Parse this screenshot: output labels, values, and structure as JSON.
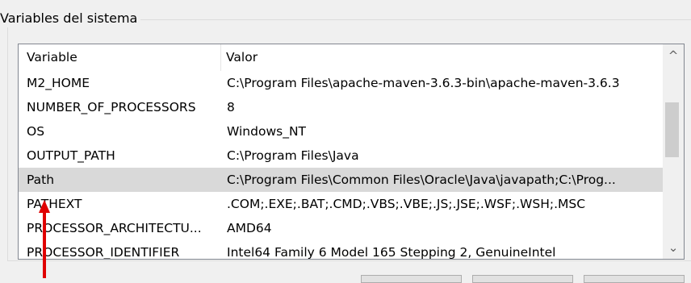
{
  "group": {
    "title": "Variables del sistema"
  },
  "list": {
    "columns": [
      "Variable",
      "Valor"
    ],
    "rows": [
      {
        "name": "M2_HOME",
        "value": "C:\\Program Files\\apache-maven-3.6.3-bin\\apache-maven-3.6.3"
      },
      {
        "name": "NUMBER_OF_PROCESSORS",
        "value": "8"
      },
      {
        "name": "OS",
        "value": "Windows_NT"
      },
      {
        "name": "OUTPUT_PATH",
        "value": "C:\\Program Files\\Java"
      },
      {
        "name": "Path",
        "value": "C:\\Program Files\\Common Files\\Oracle\\Java\\javapath;C:\\Prog...",
        "selected": true
      },
      {
        "name": "PATHEXT",
        "value": ".COM;.EXE;.BAT;.CMD;.VBS;.VBE;.JS;.JSE;.WSF;.WSH;.MSC"
      },
      {
        "name": "PROCESSOR_ARCHITECTU...",
        "value": "AMD64"
      },
      {
        "name": "PROCESSOR_IDENTIFIER",
        "value": "Intel64 Family 6 Model 165 Stepping 2, GenuineIntel"
      }
    ]
  },
  "scrollbar": {
    "up_icon": "chevron-up-icon",
    "down_icon": "chevron-down-icon",
    "up_glyph": "^",
    "down_glyph": "⌄"
  },
  "annotation": {
    "icon": "red-arrow-icon",
    "color": "#e00000"
  },
  "colors": {
    "selected_row": "#d9d9d9",
    "border": "#828790",
    "background": "#f0f0f0"
  }
}
